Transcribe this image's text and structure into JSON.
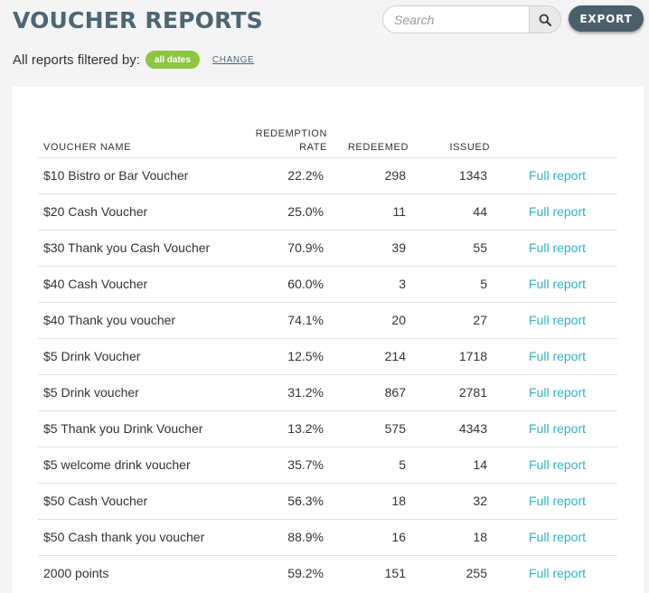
{
  "header": {
    "title": "VOUCHER REPORTS",
    "search_placeholder": "Search",
    "search_value": "",
    "export_label": "EXPORT"
  },
  "filter": {
    "label": "All reports filtered by:",
    "pill": "all dates",
    "change_label": "CHANGE"
  },
  "table": {
    "columns": {
      "name": "VOUCHER NAME",
      "rate_line1": "REDEMPTION",
      "rate_line2": "RATE",
      "redeemed": "REDEEMED",
      "issued": "ISSUED"
    },
    "link_label": "Full report",
    "rows": [
      {
        "name": "$10 Bistro or Bar Voucher",
        "rate": "22.2%",
        "redeemed": "298",
        "issued": "1343"
      },
      {
        "name": "$20 Cash Voucher",
        "rate": "25.0%",
        "redeemed": "11",
        "issued": "44"
      },
      {
        "name": "$30 Thank you Cash Voucher",
        "rate": "70.9%",
        "redeemed": "39",
        "issued": "55"
      },
      {
        "name": "$40 Cash Voucher",
        "rate": "60.0%",
        "redeemed": "3",
        "issued": "5"
      },
      {
        "name": "$40 Thank you voucher",
        "rate": "74.1%",
        "redeemed": "20",
        "issued": "27"
      },
      {
        "name": "$5 Drink Voucher",
        "rate": "12.5%",
        "redeemed": "214",
        "issued": "1718"
      },
      {
        "name": "$5 Drink voucher",
        "rate": "31.2%",
        "redeemed": "867",
        "issued": "2781"
      },
      {
        "name": "$5 Thank you Drink Voucher",
        "rate": "13.2%",
        "redeemed": "575",
        "issued": "4343"
      },
      {
        "name": "$5 welcome drink voucher",
        "rate": "35.7%",
        "redeemed": "5",
        "issued": "14"
      },
      {
        "name": "$50 Cash Voucher",
        "rate": "56.3%",
        "redeemed": "18",
        "issued": "32"
      },
      {
        "name": "$50 Cash thank you voucher",
        "rate": "88.9%",
        "redeemed": "16",
        "issued": "18"
      },
      {
        "name": "2000 points",
        "rate": "59.2%",
        "redeemed": "151",
        "issued": "255"
      }
    ]
  },
  "colors": {
    "title": "#4d6673",
    "export_button": "#4b5f6a",
    "filter_pill": "#8cc63f",
    "link": "#2eb4c8",
    "background": "#f4f4f4"
  },
  "icons": {
    "search": "search-icon"
  }
}
